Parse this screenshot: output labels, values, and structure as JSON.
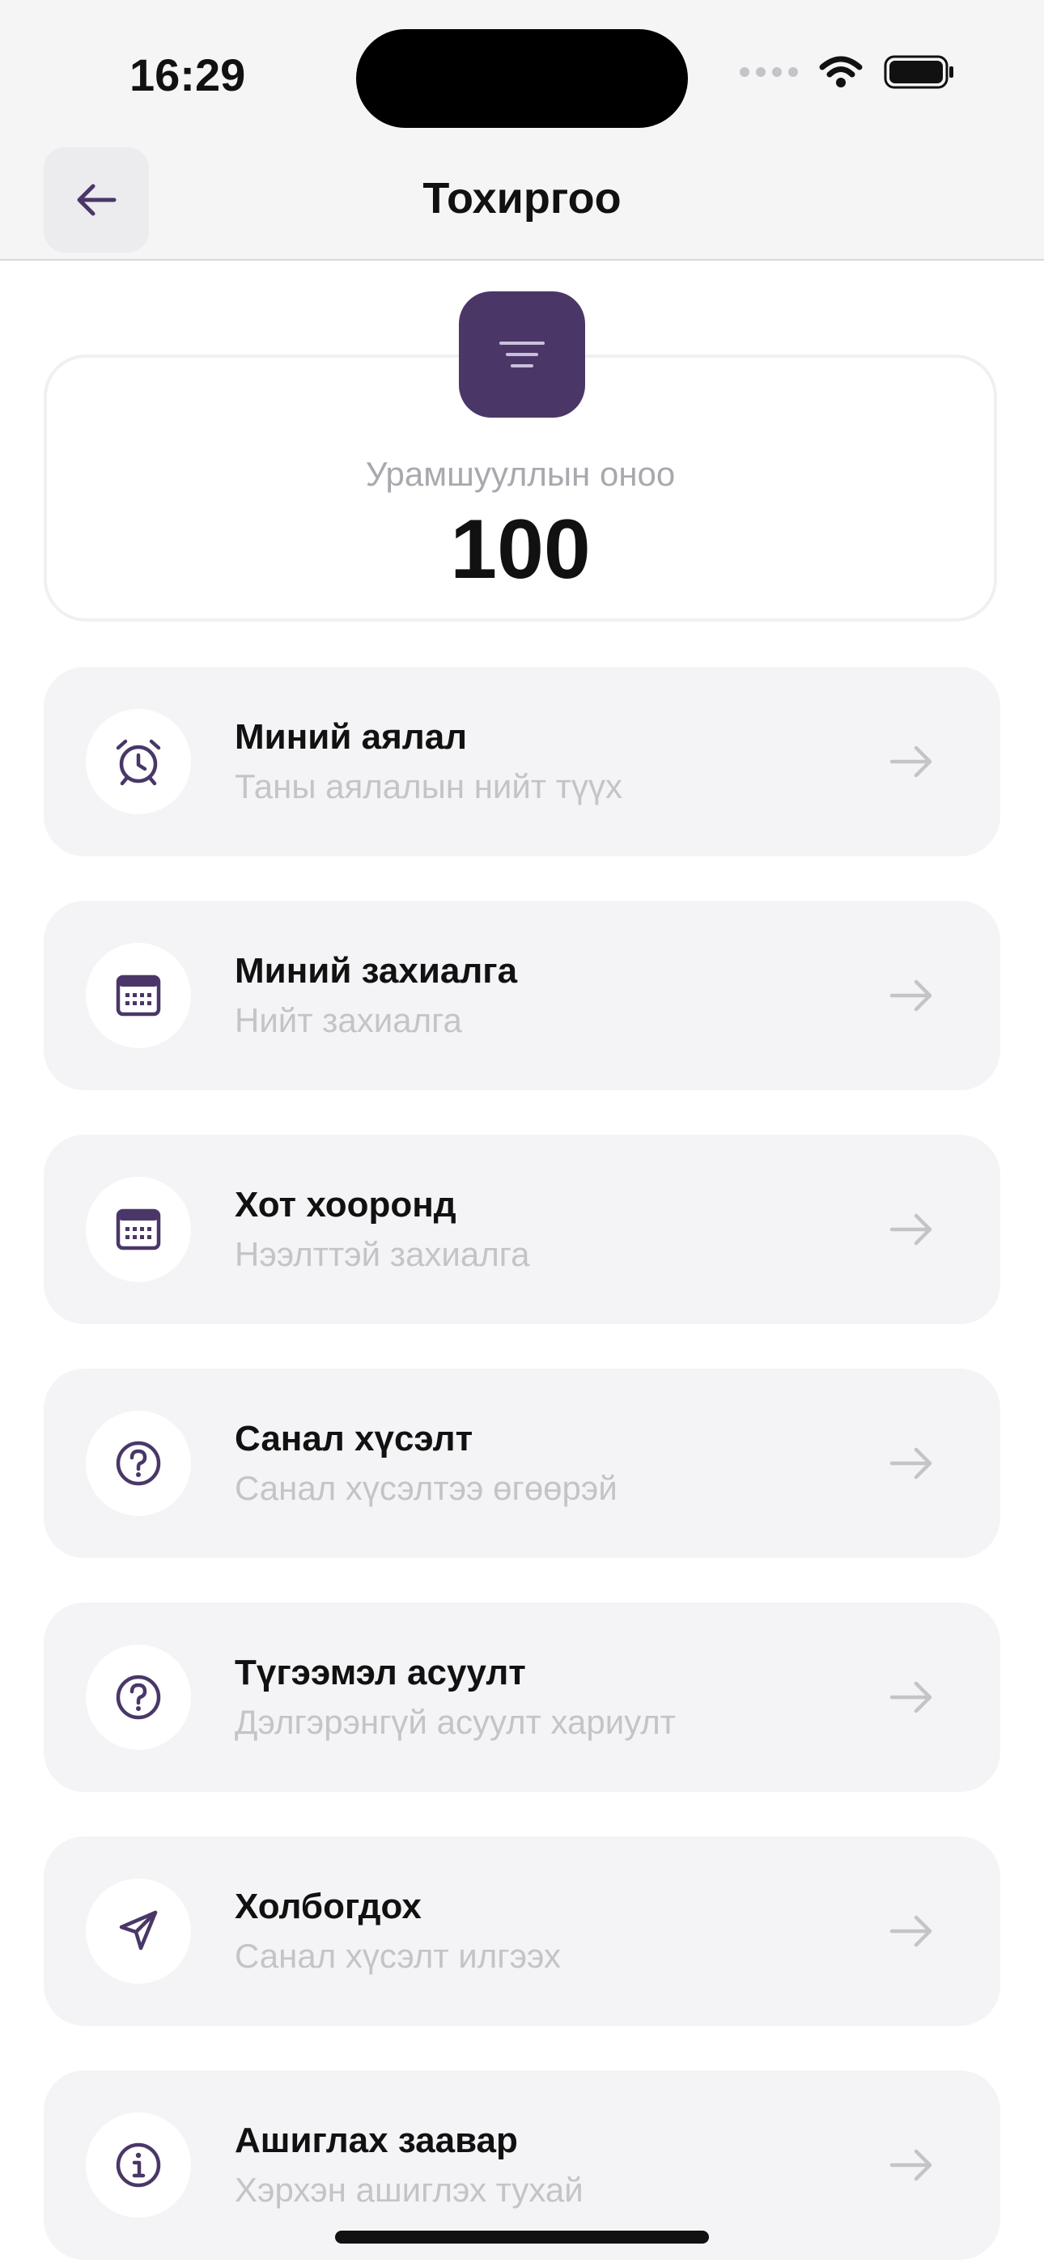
{
  "status_bar": {
    "time": "16:29"
  },
  "header": {
    "title": "Тохиргоо"
  },
  "points": {
    "label": "Урамшууллын оноо",
    "value": "100"
  },
  "menu": [
    {
      "title": "Миний аялал",
      "subtitle": "Таны аялалын нийт түүх",
      "icon": "alarm-clock-icon"
    },
    {
      "title": "Миний захиалга",
      "subtitle": "Нийт захиалга",
      "icon": "calendar-icon"
    },
    {
      "title": "Хот хооронд",
      "subtitle": "Нээлттэй захиалга",
      "icon": "calendar-icon"
    },
    {
      "title": "Санал хүсэлт",
      "subtitle": "Санал хүсэлтээ өгөөрэй",
      "icon": "question-circle-icon"
    },
    {
      "title": "Түгээмэл асуулт",
      "subtitle": "Дэлгэрэнгүй асуулт хариулт",
      "icon": "question-circle-icon"
    },
    {
      "title": "Холбогдох",
      "subtitle": "Санал хүсэлт илгээх",
      "icon": "navigation-arrow-icon"
    },
    {
      "title": "Ашиглах заавар",
      "subtitle": "Хэрхэн ашиглэх тухай",
      "icon": "info-circle-icon"
    }
  ],
  "colors": {
    "accent": "#4a3768",
    "card_bg": "#f4f4f6",
    "muted_text": "#c4c4c8"
  }
}
